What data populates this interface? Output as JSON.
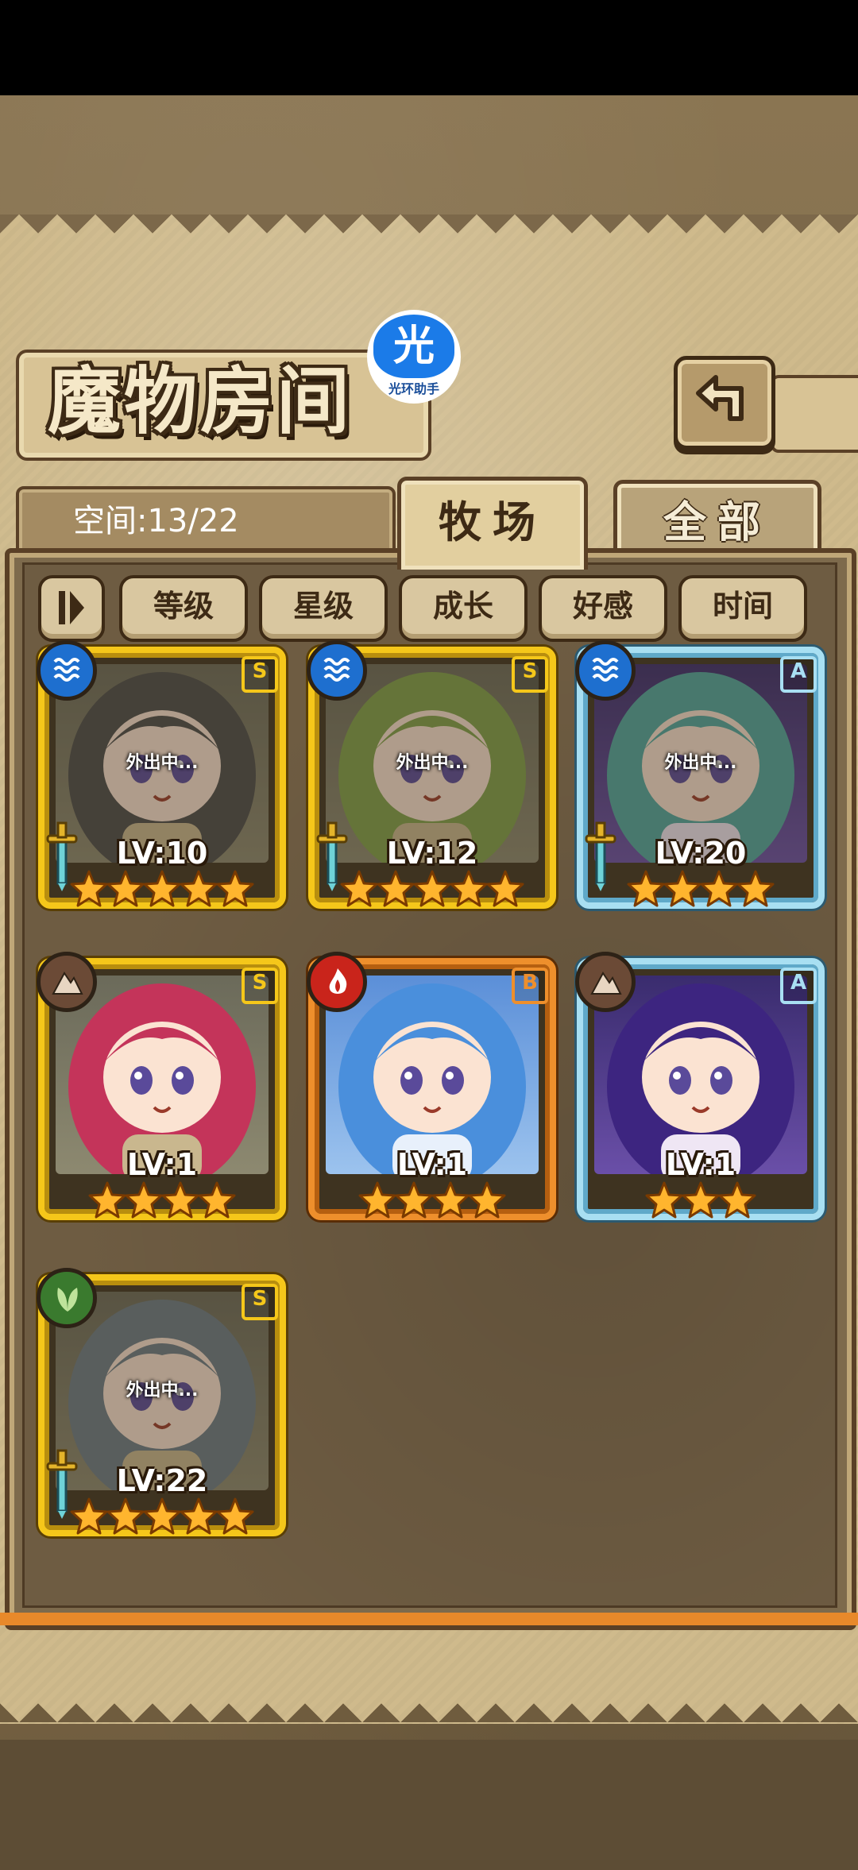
{
  "screen": {
    "title": "魔物房间",
    "space_label": "空间:13/22",
    "helper_badge": {
      "glyph": "光",
      "label": "光环助手"
    },
    "tabs": [
      {
        "label": "牧场",
        "active": true
      },
      {
        "label": "全部",
        "active": false
      }
    ],
    "sort_buttons": [
      "等级",
      "星级",
      "成长",
      "好感",
      "时间"
    ],
    "away_text": "外出中..."
  },
  "monsters": [
    {
      "level": "LV:10",
      "rank": "S",
      "stars": 5,
      "element": "water",
      "frame": "gold",
      "away": true,
      "sword": true
    },
    {
      "level": "LV:12",
      "rank": "S",
      "stars": 5,
      "element": "water",
      "frame": "gold",
      "away": true,
      "sword": true
    },
    {
      "level": "LV:20",
      "rank": "A",
      "stars": 4,
      "element": "water",
      "frame": "blue",
      "away": true,
      "sword": true
    },
    {
      "level": "LV:1",
      "rank": "S",
      "stars": 4,
      "element": "earth",
      "frame": "gold",
      "away": false,
      "sword": false
    },
    {
      "level": "LV:1",
      "rank": "B",
      "stars": 4,
      "element": "fire",
      "frame": "orange",
      "away": false,
      "sword": false
    },
    {
      "level": "LV:1",
      "rank": "A",
      "stars": 3,
      "element": "earth",
      "frame": "blue",
      "away": false,
      "sword": false
    },
    {
      "level": "LV:22",
      "rank": "S",
      "stars": 5,
      "element": "leaf",
      "frame": "gold",
      "away": true,
      "sword": true
    }
  ],
  "colors": {
    "gold_frame": "#f5c71a",
    "orange_frame": "#ee8f2c",
    "blue_frame": "#a8dff2",
    "accent_orange": "#e8892a",
    "helper_blue": "#1b7be8"
  }
}
